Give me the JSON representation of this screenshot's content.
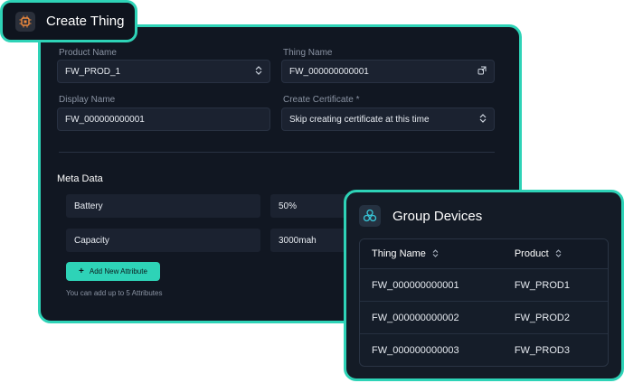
{
  "create_thing": {
    "title": "Create Thing",
    "product_name": {
      "label": "Product Name",
      "value": "FW_PROD_1"
    },
    "thing_name": {
      "label": "Thing Name",
      "value": "FW_000000000001"
    },
    "display_name": {
      "label": "Display Name",
      "value": "FW_000000000001"
    },
    "create_certificate": {
      "label": "Create Certificate *",
      "value": "Skip creating certificate at this time"
    },
    "meta_data": {
      "title": "Meta Data",
      "rows": [
        {
          "key": "Battery",
          "value": "50%"
        },
        {
          "key": "Capacity",
          "value": "3000mah"
        }
      ],
      "add_button": "Add New Attribute",
      "hint": "You can add up to 5 Attributes"
    }
  },
  "group_devices": {
    "title": "Group Devices",
    "columns": [
      "Thing Name",
      "Product"
    ],
    "rows": [
      [
        "FW_000000000001",
        "FW_PROD1"
      ],
      [
        "FW_000000000002",
        "FW_PROD2"
      ],
      [
        "FW_000000000003",
        "FW_PROD3"
      ]
    ]
  },
  "colors": {
    "accent": "#2ed3b7",
    "panel": "#111722",
    "icon_orange": "#f08a3c",
    "icon_teal": "#38c6d8"
  }
}
